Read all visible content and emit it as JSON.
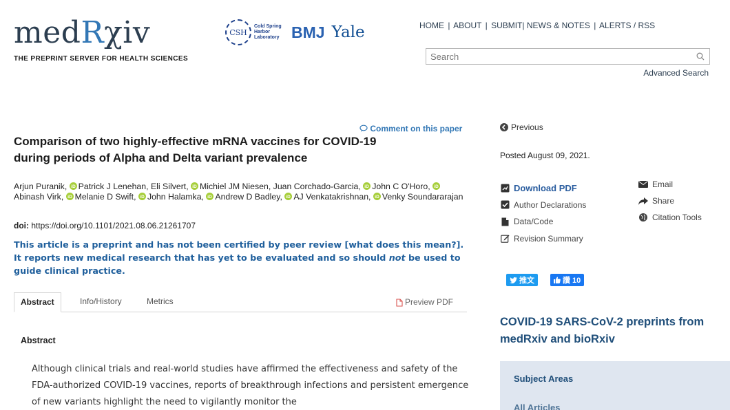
{
  "header": {
    "logo_prefix": "med",
    "logo_r": "R",
    "logo_suffix": "χiv",
    "tagline": "THE PREPRINT SERVER FOR HEALTH SCIENCES",
    "partners": {
      "csh_abbr": "CSH",
      "csh_text": "Cold Spring Harbor Laboratory",
      "bmj": "BMJ",
      "yale": "Yale"
    },
    "nav": [
      "HOME",
      "ABOUT",
      "SUBMIT",
      "NEWS & NOTES",
      "ALERTS / RSS"
    ],
    "search_placeholder": "Search",
    "advanced_search": "Advanced Search"
  },
  "article": {
    "comment_link": "Comment on this paper",
    "title": "Comparison of two highly-effective mRNA vaccines for COVID-19 during periods of Alpha and Delta variant prevalence",
    "authors": [
      {
        "name": "Arjun Puranik",
        "orcid": false
      },
      {
        "name": "Patrick J Lenehan",
        "orcid": true
      },
      {
        "name": "Eli Silvert",
        "orcid": false
      },
      {
        "name": "Michiel JM Niesen",
        "orcid": true
      },
      {
        "name": "Juan Corchado-Garcia",
        "orcid": false
      },
      {
        "name": "John C O'Horo",
        "orcid": true
      },
      {
        "name": "Abinash Virk",
        "orcid": true
      },
      {
        "name": "Melanie D Swift",
        "orcid": true
      },
      {
        "name": "John Halamka",
        "orcid": true
      },
      {
        "name": "Andrew D Badley",
        "orcid": true
      },
      {
        "name": "AJ Venkatakrishnan",
        "orcid": true
      },
      {
        "name": "Venky Soundararajan",
        "orcid": true
      }
    ],
    "doi_label": "doi:",
    "doi_url": "https://doi.org/10.1101/2021.08.06.21261707",
    "notice_part1": "This article is a preprint and has not been certified by peer review [what does this mean?]. It reports new medical research that has yet to be evaluated and so should ",
    "notice_emph": "not",
    "notice_part2": " be used to guide clinical practice.",
    "tabs": [
      "Abstract",
      "Info/History",
      "Metrics"
    ],
    "preview_pdf": "Preview PDF",
    "abstract_heading": "Abstract",
    "abstract_text": "Although clinical trials and real-world studies have affirmed the effectiveness and safety of the FDA-authorized COVID-19 vaccines, reports of breakthrough infections and persistent emergence of new variants highlight the need to vigilantly monitor the"
  },
  "sidebar": {
    "previous": "Previous",
    "posted": "Posted August 09, 2021.",
    "tools_left": [
      "Download PDF",
      "Author Declarations",
      "Data/Code",
      "Revision Summary"
    ],
    "tools_right": [
      "Email",
      "Share",
      "Citation Tools"
    ],
    "tweet_label": "推文",
    "like_label": "讚 10",
    "covid_heading": "COVID-19 SARS-CoV-2 preprints from medRxiv and bioRxiv",
    "subject_areas": "Subject Areas",
    "all_articles": "All Articles"
  },
  "colors": {
    "link_blue": "#3277b5",
    "notice_blue": "#1f5f9c",
    "orcid_green": "#a6ce39",
    "panel_bg": "#dfe6f0"
  }
}
